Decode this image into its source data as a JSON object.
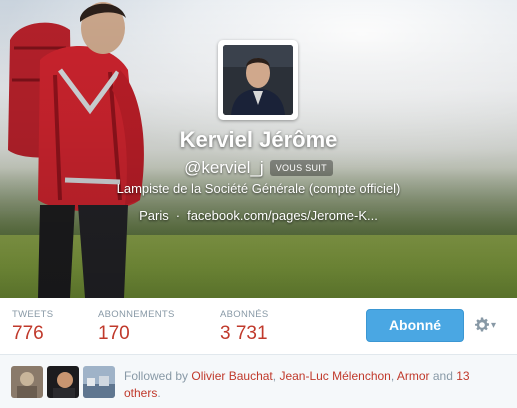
{
  "profile": {
    "name": "Kerviel Jérôme",
    "handle": "@kerviel_j",
    "follows_you_badge": "VOUS SUIT",
    "bio": "Lampiste de la Société Générale (compte officiel)",
    "location": "Paris",
    "separator": "·",
    "website": "facebook.com/pages/Jerome-K..."
  },
  "stats": [
    {
      "label": "TWEETS",
      "value": "776"
    },
    {
      "label": "ABONNEMENTS",
      "value": "170"
    },
    {
      "label": "ABONNÉS",
      "value": "3 731"
    }
  ],
  "actions": {
    "follow_label": "Abonné",
    "settings_icon": "gear-icon"
  },
  "followed_by": {
    "prefix": "Followed by",
    "users": [
      "Olivier Bauchat",
      "Jean-Luc Mélenchon",
      "Armor"
    ],
    "comma": ",",
    "and": "and",
    "others": "13 others",
    "period": "."
  },
  "colors": {
    "accent": "#c0392b",
    "button": "#4aa7e3",
    "muted": "#8899a6"
  }
}
